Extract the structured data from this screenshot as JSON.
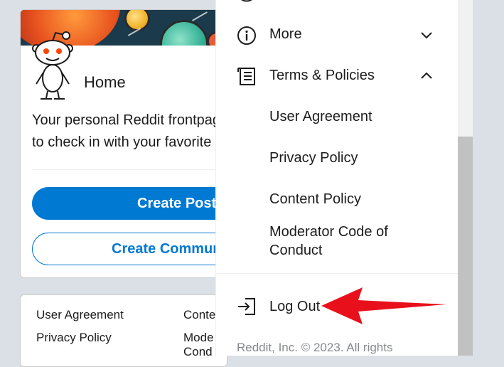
{
  "home": {
    "title": "Home",
    "description": "Your personal Reddit frontpage. Come here\nto check in with your favorite communities.",
    "create_post": "Create Post",
    "create_community": "Create Community"
  },
  "footer": {
    "links": [
      "User Agreement",
      "Privacy Policy",
      "Content Policy",
      "Moderator Code of Conduct"
    ],
    "col2_top": "Conte",
    "col2_mid": "Mode",
    "col2_bottom": "Cond"
  },
  "menu": {
    "more_label": "More",
    "terms_label": "Terms & Policies",
    "sub_items": [
      "User Agreement",
      "Privacy Policy",
      "Content Policy",
      "Moderator Code of\nConduct"
    ],
    "logout_label": "Log Out",
    "copyright": "Reddit, Inc. © 2023. All rights"
  },
  "colors": {
    "accent": "#0079d3",
    "arrow": "#e8101a",
    "background": "#dae0e6"
  },
  "icons": [
    "info-icon",
    "policy-doc-icon",
    "chevron-down-icon",
    "chevron-up-icon",
    "logout-icon",
    "snoo-mascot",
    "partial-top-icon"
  ]
}
